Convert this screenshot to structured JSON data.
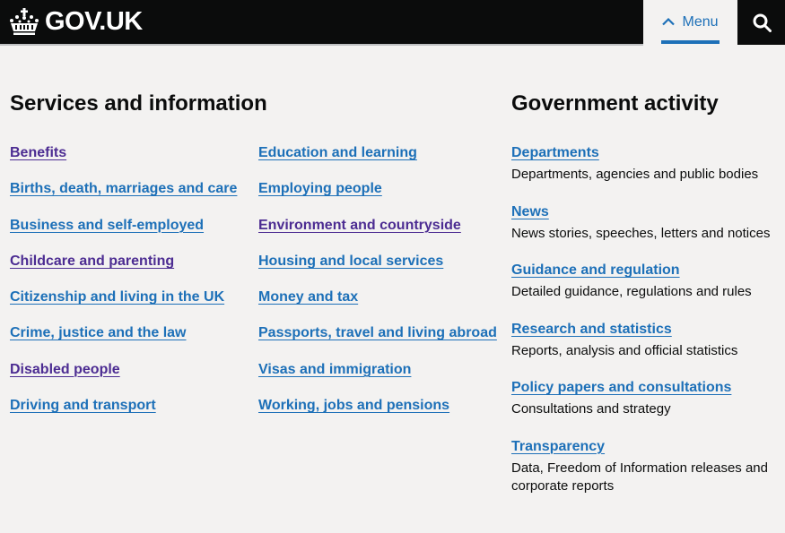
{
  "header": {
    "logo_text": "GOV.UK",
    "logo_icon": "crown-icon",
    "menu_label": "Menu",
    "menu_icon": "chevron-up-icon",
    "search_icon": "search-icon"
  },
  "services": {
    "title": "Services and information",
    "column1": [
      {
        "label": "Benefits",
        "visited": true
      },
      {
        "label": "Births, death, marriages and care",
        "visited": false
      },
      {
        "label": "Business and self-employed",
        "visited": false
      },
      {
        "label": "Childcare and parenting",
        "visited": true
      },
      {
        "label": "Citizenship and living in the UK",
        "visited": false
      },
      {
        "label": "Crime, justice and the law",
        "visited": false
      },
      {
        "label": "Disabled people",
        "visited": true
      },
      {
        "label": "Driving and transport",
        "visited": false
      }
    ],
    "column2": [
      {
        "label": "Education and learning",
        "visited": false
      },
      {
        "label": "Employing people",
        "visited": false
      },
      {
        "label": "Environment and countryside",
        "visited": true
      },
      {
        "label": "Housing and local services",
        "visited": false
      },
      {
        "label": "Money and tax",
        "visited": false
      },
      {
        "label": "Passports, travel and living abroad",
        "visited": false
      },
      {
        "label": "Visas and immigration",
        "visited": false
      },
      {
        "label": "Working, jobs and pensions",
        "visited": false
      }
    ]
  },
  "government": {
    "title": "Government activity",
    "items": [
      {
        "label": "Departments",
        "description": "Departments, agencies and public bodies"
      },
      {
        "label": "News",
        "description": "News stories, speeches, letters and notices"
      },
      {
        "label": "Guidance and regulation",
        "description": "Detailed guidance, regulations and rules"
      },
      {
        "label": "Research and statistics",
        "description": "Reports, analysis and official statistics"
      },
      {
        "label": "Policy papers and consultations",
        "description": "Consultations and strategy"
      },
      {
        "label": "Transparency",
        "description": "Data, Freedom of Information releases and corporate reports"
      }
    ]
  },
  "colors": {
    "header_bg": "#0b0c0c",
    "page_bg": "#f3f2f1",
    "link": "#1d70b8",
    "link_visited": "#4c2c92",
    "text": "#0b0c0c"
  }
}
